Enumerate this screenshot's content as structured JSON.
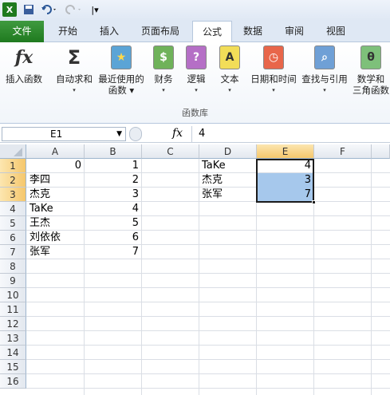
{
  "quick_access": {
    "excel_icon": "X",
    "more": "|▾"
  },
  "tabs": [
    "文件",
    "开始",
    "插入",
    "页面布局",
    "公式",
    "数据",
    "审阅",
    "视图"
  ],
  "ribbon": {
    "buttons": [
      {
        "line1": "插入函数",
        "line2": ""
      },
      {
        "line1": "自动求和",
        "line2": "▾"
      },
      {
        "line1": "最近使用的",
        "line2": "函数 ▾"
      },
      {
        "line1": "财务",
        "line2": "▾"
      },
      {
        "line1": "逻辑",
        "line2": "▾"
      },
      {
        "line1": "文本",
        "line2": "▾"
      },
      {
        "line1": "日期和时间",
        "line2": "▾"
      },
      {
        "line1": "查找与引用",
        "line2": "▾"
      },
      {
        "line1": "数学和",
        "line2": "三角函数"
      }
    ],
    "group_label": "函数库"
  },
  "formula_bar": {
    "name_box": "E1",
    "fx": "fx",
    "value": "4"
  },
  "columns": [
    "A",
    "B",
    "C",
    "D",
    "E",
    "F"
  ],
  "rows": [
    "1",
    "2",
    "3",
    "4",
    "5",
    "6",
    "7",
    "8",
    "9",
    "10",
    "11",
    "12",
    "13",
    "14",
    "15",
    "16"
  ],
  "cells": {
    "A1": "0",
    "A2": "李四",
    "A3": "杰克",
    "A4": "TaKe",
    "A5": "王杰",
    "A6": "刘依依",
    "A7": "张军",
    "B1": "1",
    "B2": "2",
    "B3": "3",
    "B4": "4",
    "B5": "5",
    "B6": "6",
    "B7": "7",
    "D1": "TaKe",
    "D2": "杰克",
    "D3": "张军",
    "E1": "4",
    "E2": "3",
    "E3": "7"
  },
  "colors": {
    "file_tab": "#2a8a2a",
    "selection_fill": "#a6c8ec",
    "active_header": "#f8d88a"
  }
}
